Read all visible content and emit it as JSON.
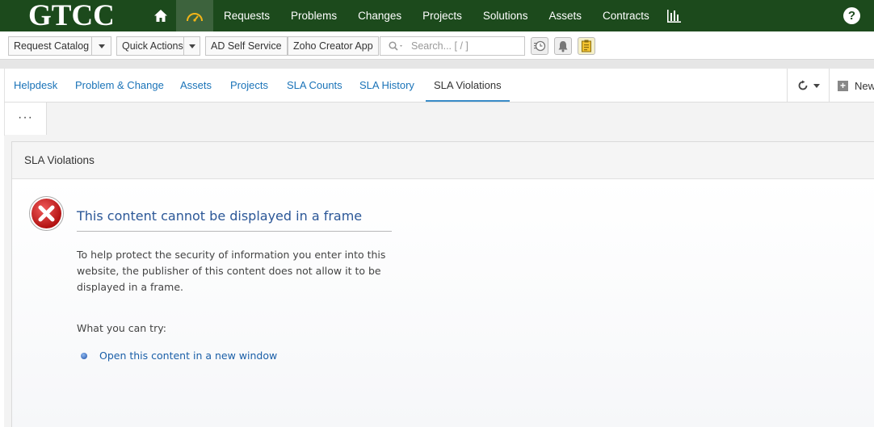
{
  "brand": {
    "logo_text": "GTCC"
  },
  "colors": {
    "nav_bg": "#1c4a1c",
    "nav_active": "#3d633d",
    "link": "#1a73b8",
    "error_title": "#2b5797"
  },
  "topnav": {
    "items": [
      "Requests",
      "Problems",
      "Changes",
      "Projects",
      "Solutions",
      "Assets",
      "Contracts"
    ],
    "help_label": "?"
  },
  "toolbar": {
    "request_catalog": "Request Catalog",
    "quick_actions": "Quick Actions",
    "ad_self_service": "AD Self Service",
    "zoho_creator": "Zoho Creator App",
    "search_placeholder": "Search... [ / ]"
  },
  "tabs": {
    "items": [
      "Helpdesk",
      "Problem & Change",
      "Assets",
      "Projects",
      "SLA Counts",
      "SLA History",
      "SLA Violations"
    ],
    "active": "SLA Violations",
    "new_label": "New"
  },
  "subbar": {
    "more_label": "···"
  },
  "panel": {
    "title": "SLA Violations",
    "error_title": "This content cannot be displayed in a frame",
    "error_text": "To help protect the security of information you enter into this website, the publisher of this content does not allow it to be displayed in a frame.",
    "try_label": "What you can try:",
    "open_link": "Open this content in a new window"
  }
}
